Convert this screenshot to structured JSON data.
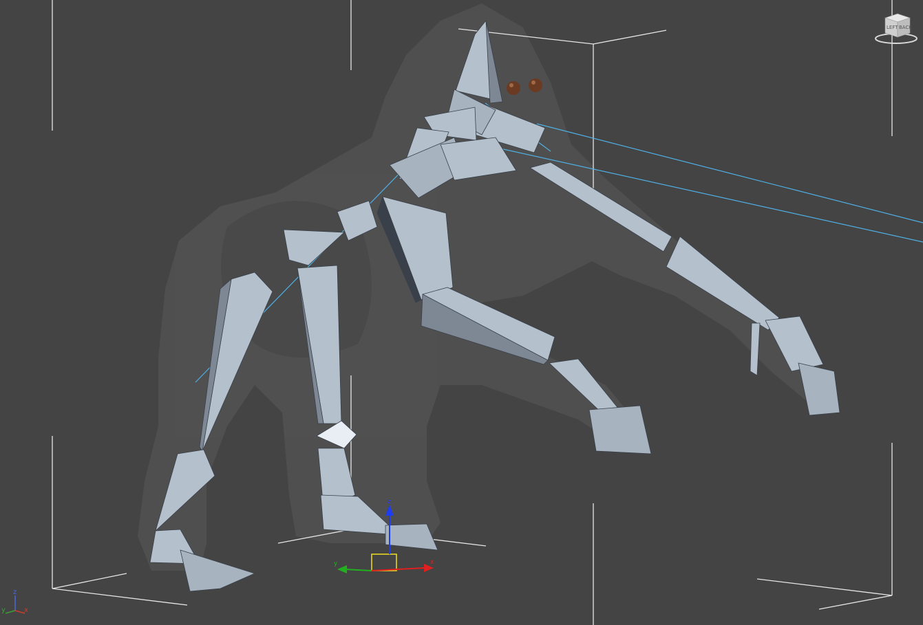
{
  "viewport": {
    "background": "#444444",
    "name": "perspective-viewport"
  },
  "world_axis": {
    "x_label": "x",
    "y_label": "y",
    "z_label": "z",
    "x_color": "#d23a2a",
    "y_color": "#3aa03a",
    "z_color": "#4a6ad8"
  },
  "move_gizmo": {
    "x_label": "x",
    "y_label": "y",
    "z_label": "z",
    "x_color": "#e02020",
    "y_color": "#20b020",
    "z_color": "#1e3cf0",
    "plane_color": "#f0e020"
  },
  "viewcube": {
    "face_left": "LEFT",
    "face_right": "BACK"
  },
  "colors": {
    "bone": "#b4c0cc",
    "bone_shade": "#7e8894",
    "bone_dark": "#39404a",
    "mesh": "#545454",
    "link": "#4fb0e6",
    "grid": "#e6e6e6",
    "eye": "#6b3a22"
  }
}
